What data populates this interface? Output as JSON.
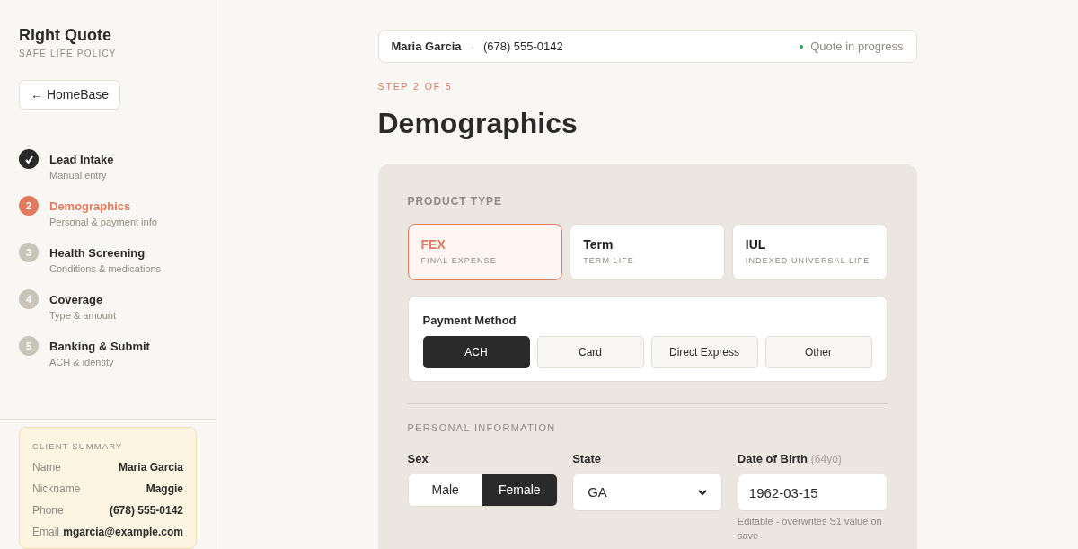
{
  "sidebar": {
    "brand": "Right Quote",
    "tagline": "SAFE LIFE POLICY",
    "back_button": "← HomeBase",
    "steps": [
      {
        "title": "Lead Intake",
        "subtitle": "Manual entry",
        "kind": "done"
      },
      {
        "number": "2",
        "title": "Demographics",
        "subtitle": "Personal & payment info",
        "kind": "current"
      },
      {
        "number": "3",
        "title": "Health Screening",
        "subtitle": "Conditions & medications",
        "kind": "upcoming"
      },
      {
        "number": "4",
        "title": "Coverage",
        "subtitle": "Type & amount",
        "kind": "upcoming"
      },
      {
        "number": "5",
        "title": "Banking & Submit",
        "subtitle": "ACH & identity",
        "kind": "upcoming"
      }
    ],
    "client_summary": {
      "title": "CLIENT SUMMARY",
      "rows": [
        {
          "label": "Name",
          "value": "Maria Garcia"
        },
        {
          "label": "Nickname",
          "value": "Maggie"
        },
        {
          "label": "Phone",
          "value": "(678) 555-0142"
        },
        {
          "label": "Email",
          "value": "mgarcia@example.com"
        }
      ]
    }
  },
  "header": {
    "client_name": "Maria Garcia",
    "separator": "·",
    "phone": "(678) 555-0142",
    "status": "Quote in progress"
  },
  "step_label": "STEP 2 OF 5",
  "page_title": "Demographics",
  "form": {
    "product_type": {
      "title": "PRODUCT TYPE",
      "options": [
        {
          "code": "FEX",
          "name": "FINAL EXPENSE",
          "selected": true
        },
        {
          "code": "Term",
          "name": "TERM LIFE",
          "selected": false
        },
        {
          "code": "IUL",
          "name": "INDEXED UNIVERSAL LIFE",
          "selected": false
        }
      ]
    },
    "payment_method": {
      "title": "Payment Method",
      "options": [
        {
          "label": "ACH",
          "selected": true
        },
        {
          "label": "Card",
          "selected": false
        },
        {
          "label": "Direct Express",
          "selected": false
        },
        {
          "label": "Other",
          "selected": false
        }
      ]
    },
    "personal_information": {
      "title": "PERSONAL INFORMATION",
      "sex": {
        "label": "Sex",
        "options": [
          {
            "label": "Male",
            "selected": false
          },
          {
            "label": "Female",
            "selected": true
          }
        ]
      },
      "state": {
        "label": "State",
        "value": "GA"
      },
      "date_of_birth": {
        "label": "Date of Birth",
        "age_note": "(64yo)",
        "value": "1962-03-15",
        "help": "Editable - overwrites S1 value on save"
      }
    }
  }
}
